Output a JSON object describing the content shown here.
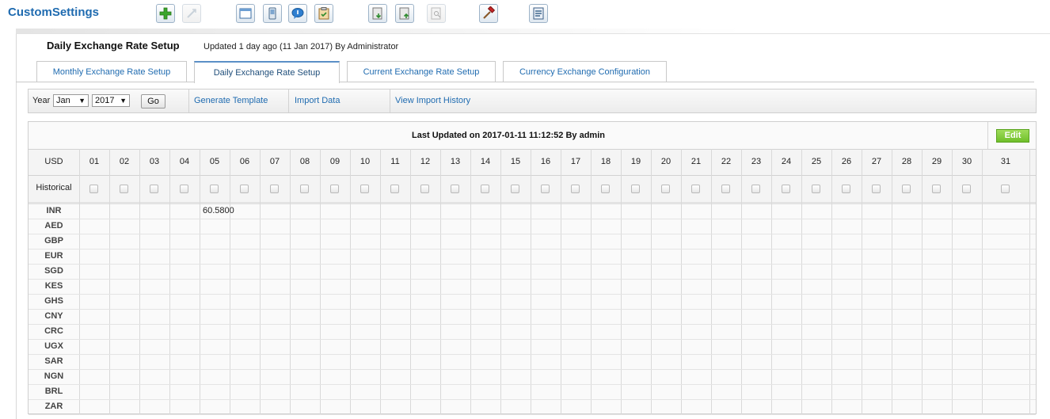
{
  "app": {
    "title": "CustomSettings"
  },
  "toolbar": {
    "buttons": [
      {
        "name": "add-button",
        "icon": "plus-icon",
        "enabled": true
      },
      {
        "name": "link-button",
        "icon": "link-icon",
        "enabled": false
      },
      {
        "name": "window-button",
        "icon": "window-icon",
        "enabled": true
      },
      {
        "name": "mobile-button",
        "icon": "mobile-icon",
        "enabled": true
      },
      {
        "name": "chat-button",
        "icon": "chat-bubble-icon",
        "enabled": true
      },
      {
        "name": "clipboard-button",
        "icon": "clipboard-icon",
        "enabled": true
      },
      {
        "name": "export-button",
        "icon": "document-down-icon",
        "enabled": true
      },
      {
        "name": "import-button",
        "icon": "document-up-icon",
        "enabled": true
      },
      {
        "name": "preview-button",
        "icon": "document-search-icon",
        "enabled": false
      },
      {
        "name": "tools-button",
        "icon": "hammer-icon",
        "enabled": true
      },
      {
        "name": "settings-button",
        "icon": "document-settings-icon",
        "enabled": true
      }
    ]
  },
  "page": {
    "title": "Daily Exchange Rate Setup",
    "meta": "Updated 1 day ago (11 Jan 2017) By Administrator"
  },
  "tabs": [
    {
      "label": "Monthly Exchange Rate Setup",
      "active": false
    },
    {
      "label": "Daily Exchange Rate Setup",
      "active": true
    },
    {
      "label": "Current Exchange Rate Setup",
      "active": false
    },
    {
      "label": "Currency Exchange Configuration",
      "active": false
    }
  ],
  "filter": {
    "year_label": "Year",
    "month_value": "Jan",
    "year_value": "2017",
    "go_label": "Go",
    "links": [
      "Generate Template",
      "Import Data",
      "View Import History"
    ]
  },
  "grid": {
    "last_updated": "Last Updated on 2017-01-11 11:12:52 By admin",
    "edit_label": "Edit",
    "base_currency": "USD",
    "historical_label": "Historical",
    "days": [
      "01",
      "02",
      "03",
      "04",
      "05",
      "06",
      "07",
      "08",
      "09",
      "10",
      "11",
      "12",
      "13",
      "14",
      "15",
      "16",
      "17",
      "18",
      "19",
      "20",
      "21",
      "22",
      "23",
      "24",
      "25",
      "26",
      "27",
      "28",
      "29",
      "30",
      "31"
    ],
    "currencies": [
      "INR",
      "AED",
      "GBP",
      "EUR",
      "SGD",
      "KES",
      "GHS",
      "CNY",
      "CRC",
      "UGX",
      "SAR",
      "NGN",
      "BRL",
      "ZAR"
    ],
    "values": [
      {
        "currency": "INR",
        "day": "05",
        "value": "60.5800"
      }
    ]
  },
  "colors": {
    "accent_blue": "#1f6bb0",
    "edit_green": "#7cc83a"
  }
}
